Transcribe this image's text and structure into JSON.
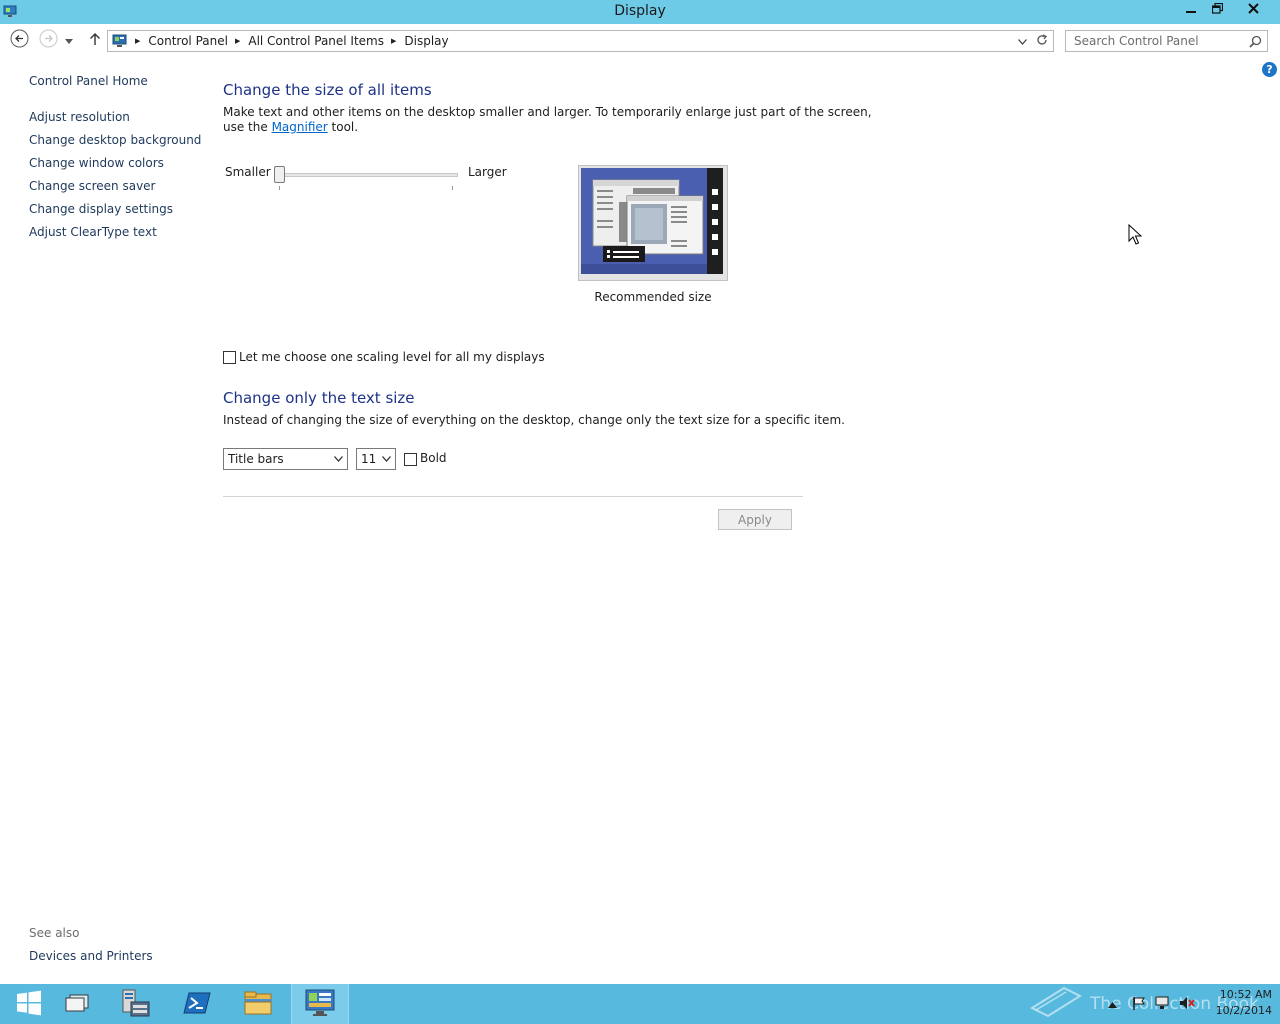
{
  "window": {
    "title": "Display",
    "minimize_icon": "minimize-icon",
    "maximize_icon": "restore-icon",
    "close_icon": "close-icon"
  },
  "navigation": {
    "back_icon": "back-arrow-icon",
    "forward_icon": "forward-arrow-icon",
    "recent_icon": "chevron-down-icon",
    "up_icon": "up-arrow-icon",
    "breadcrumb": [
      "Control Panel",
      "All Control Panel Items",
      "Display"
    ],
    "search_placeholder": "Search Control Panel"
  },
  "sidebar": {
    "home": "Control Panel Home",
    "items": [
      "Adjust resolution",
      "Change desktop background",
      "Change window colors",
      "Change screen saver",
      "Change display settings",
      "Adjust ClearType text"
    ],
    "see_also_title": "See also",
    "see_also_items": [
      "Devices and Printers"
    ]
  },
  "main": {
    "size_heading": "Change the size of all items",
    "size_desc_1": "Make text and other items on the desktop smaller and larger. To temporarily enlarge just part of the screen,",
    "size_desc_2a": "use the ",
    "magnifier_link": "Magnifier",
    "size_desc_2b": " tool.",
    "slider_min_label": "Smaller",
    "slider_max_label": "Larger",
    "slider_position": 0,
    "preview_label": "Recommended size",
    "scaling_checkbox_label": "Let me choose one scaling level for all my displays",
    "scaling_checked": false,
    "text_heading": "Change only the text size",
    "text_desc": "Instead of changing the size of everything on the desktop, change only the text size for a specific item.",
    "item_select": "Title bars",
    "size_select": "11",
    "bold_label": "Bold",
    "bold_checked": false,
    "apply_label": "Apply"
  },
  "taskbar": {
    "items": [
      "start-icon",
      "task-view-icon",
      "server-manager-icon",
      "powershell-icon",
      "file-explorer-icon",
      "control-panel-icon"
    ],
    "watermark": "The Collection Book",
    "clock_time": "10:52 AM",
    "clock_date": "10/2/2014"
  },
  "colors": {
    "titlebar": "#6ecbe8",
    "taskbar": "#58b9de",
    "heading": "#1e3287",
    "link": "#1e395b"
  }
}
